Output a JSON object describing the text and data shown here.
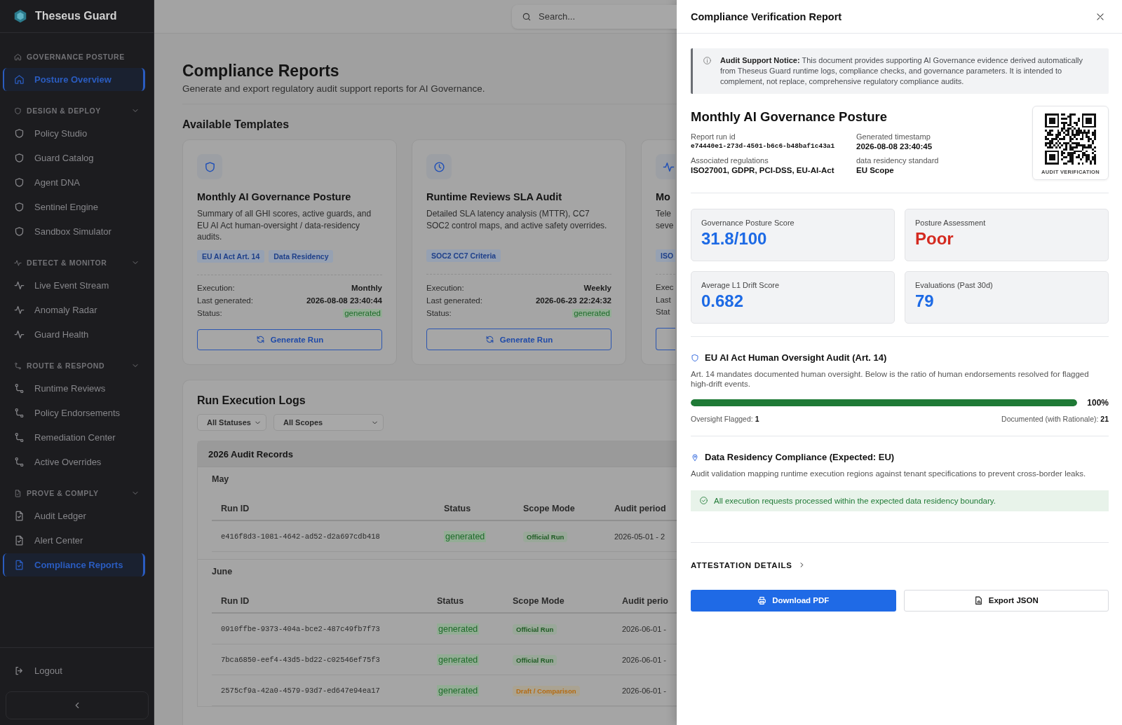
{
  "app": {
    "name": "Theseus Guard"
  },
  "sidebar": {
    "sections": [
      {
        "title": "GOVERNANCE POSTURE",
        "kind": "home",
        "expanded": false,
        "items": [
          {
            "label": "Posture Overview",
            "selected": true
          }
        ]
      },
      {
        "title": "DESIGN & DEPLOY",
        "kind": "shield",
        "expanded": true,
        "items": [
          {
            "label": "Policy Studio",
            "selected": false
          },
          {
            "label": "Guard Catalog",
            "selected": false
          },
          {
            "label": "Agent DNA",
            "selected": false
          },
          {
            "label": "Sentinel Engine",
            "selected": false
          },
          {
            "label": "Sandbox Simulator",
            "selected": false
          }
        ]
      },
      {
        "title": "DETECT & MONITOR",
        "kind": "pulse",
        "expanded": true,
        "items": [
          {
            "label": "Live Event Stream",
            "selected": false
          },
          {
            "label": "Anomaly Radar",
            "selected": false
          },
          {
            "label": "Guard Health",
            "selected": false
          }
        ]
      },
      {
        "title": "ROUTE & RESPOND",
        "kind": "route",
        "expanded": true,
        "items": [
          {
            "label": "Runtime Reviews",
            "selected": false
          },
          {
            "label": "Policy Endorsements",
            "selected": false
          },
          {
            "label": "Remediation Center",
            "selected": false
          },
          {
            "label": "Active Overrides",
            "selected": false
          }
        ]
      },
      {
        "title": "PROVE & COMPLY",
        "kind": "file",
        "expanded": true,
        "items": [
          {
            "label": "Audit Ledger",
            "selected": false
          },
          {
            "label": "Alert Center",
            "selected": false
          },
          {
            "label": "Compliance Reports",
            "selected": true
          }
        ]
      }
    ],
    "logout": "Logout"
  },
  "search": {
    "placeholder": "Search..."
  },
  "page": {
    "title": "Compliance Reports",
    "subtitle": "Generate and export regulatory audit support reports for AI Governance."
  },
  "templates": {
    "heading": "Available Templates",
    "cards": [
      {
        "kind": "shield",
        "title": "Monthly AI Governance Posture",
        "description": "Summary of all GHI scores, active guards, and EU AI Act human-oversight / data-residency audits.",
        "tags": [
          "EU AI Act Art. 14",
          "Data Residency"
        ],
        "rows": [
          {
            "label": "Execution:",
            "value": "Monthly",
            "kind": "text"
          },
          {
            "label": "Last generated:",
            "value": "2026-08-08 23:40:44",
            "kind": "text"
          },
          {
            "label": "Status:",
            "value": "generated",
            "kind": "badge"
          }
        ],
        "button": "Generate Run",
        "clipped": false
      },
      {
        "kind": "clock",
        "title": "Runtime Reviews SLA Audit",
        "description": "Detailed SLA latency analysis (MTTR), CC7 SOC2 control maps, and active safety overrides.",
        "tags": [
          "SOC2 CC7 Criteria"
        ],
        "rows": [
          {
            "label": "Execution:",
            "value": "Weekly",
            "kind": "text"
          },
          {
            "label": "Last generated:",
            "value": "2026-06-23 22:24:32",
            "kind": "text"
          },
          {
            "label": "Status:",
            "value": "generated",
            "kind": "badge"
          }
        ],
        "button": "Generate Run",
        "clipped": false
      },
      {
        "kind": "pulse",
        "title": "Mo",
        "description": "Tele seve",
        "tags": [
          "ISO"
        ],
        "rows": [
          {
            "label": "Exec",
            "kind": "text"
          },
          {
            "label": "Last",
            "kind": "text"
          },
          {
            "label": "Stat",
            "kind": "text"
          }
        ],
        "clipped": true
      }
    ]
  },
  "logs": {
    "heading": "Run Execution Logs",
    "filters": [
      "All Statuses",
      "All Scopes"
    ],
    "group_title": "2026 Audit Records",
    "months": [
      {
        "name": "May",
        "columns": [
          "Run ID",
          "Status",
          "Scope Mode",
          "Audit period"
        ],
        "rows": [
          {
            "run_id": "e416f8d3-1081-4642-ad52-d2a697cdb418",
            "status": "generated",
            "scope": "Official Run",
            "kind": "official",
            "period": "2026-05-01 - 2"
          }
        ]
      },
      {
        "name": "June",
        "columns": [
          "Run ID",
          "Status",
          "Scope Mode",
          "Audit perio"
        ],
        "rows": [
          {
            "run_id": "0910ffbe-9373-404a-bce2-487c49fb7f73",
            "status": "generated",
            "scope": "Official Run",
            "kind": "official",
            "period": "2026-06-01 -"
          },
          {
            "run_id": "7bca6850-eef4-43d5-bd22-c02546ef75f3",
            "status": "generated",
            "scope": "Official Run",
            "kind": "official",
            "period": "2026-06-01 -"
          },
          {
            "run_id": "2575cf9a-42a0-4579-93d7-ed647e94ea17",
            "status": "generated",
            "scope": "Draft / Comparison",
            "kind": "draft",
            "period": "2026-06-01 -"
          }
        ]
      }
    ]
  },
  "drawer": {
    "title": "Compliance Verification Report",
    "notice": "**Audit Support Notice:** This document provides supporting AI Governance evidence derived automatically from Theseus Guard runtime logs, compliance checks, and governance parameters. It is intended to complement, not replace, comprehensive regulatory compliance audits.",
    "report_title": "Monthly AI Governance Posture",
    "meta": [
      {
        "label": "Report run id",
        "value": "e74440e1-273d-4501-b6c6-b48baf1c43a1",
        "mono": true
      },
      {
        "label": "Generated timestamp",
        "value": "2026-08-08 23:40:45",
        "mono": false
      },
      {
        "label": "Associated regulations",
        "value": "ISO27001, GDPR, PCI-DSS, EU-AI-Act",
        "mono": false
      },
      {
        "label": "data residency standard",
        "value": "EU Scope",
        "mono": false
      }
    ],
    "qr_caption": "AUDIT VERIFICATION",
    "stats": [
      {
        "label": "Governance Posture Score",
        "value": "31.8/100",
        "kind": "accent"
      },
      {
        "label": "Posture Assessment",
        "value": "Poor",
        "kind": "danger"
      },
      {
        "label": "Average L1 Drift Score",
        "value": "0.682",
        "kind": "accent"
      },
      {
        "label": "Evaluations (Past 30d)",
        "value": "79",
        "kind": "accent"
      }
    ],
    "oversight": {
      "title": "EU AI Act Human Oversight Audit (Art. 14)",
      "description": "Art. 14 mandates documented human oversight. Below is the ratio of human endorsements resolved for flagged high-drift events.",
      "level": 1,
      "reading": "100%",
      "left": "Oversight Flagged: **1**",
      "right": "Documented (with Rationale): **21**"
    },
    "residency": {
      "title": "Data Residency Compliance (Expected: EU)",
      "description": "Audit validation mapping runtime execution regions against tenant specifications to prevent cross-border leaks.",
      "banner": "All execution requests processed within the expected data residency boundary."
    },
    "attestation": "ATTESTATION DETAILS",
    "actions": [
      {
        "label": "Download PDF",
        "kind": "primary"
      },
      {
        "label": "Export JSON",
        "kind": "secondary"
      }
    ]
  }
}
